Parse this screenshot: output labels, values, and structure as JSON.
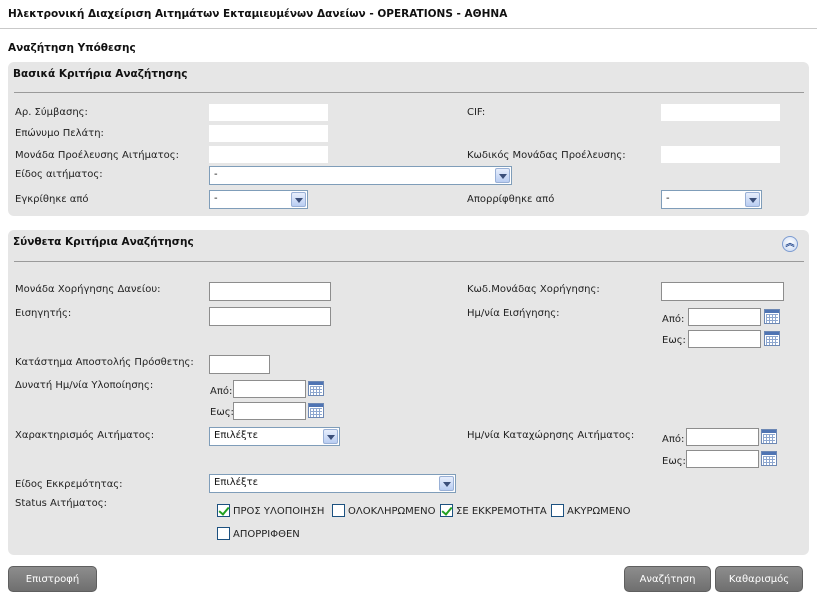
{
  "header": {
    "app_title": "Ηλεκτρονική Διαχείριση Αιτημάτων Εκταμιευμένων Δανείων - OPERATIONS - ΑΘΗΝΑ",
    "page_title": "Αναζήτηση Υπόθεσης"
  },
  "basic": {
    "heading": "Βασικά Κριτήρια Αναζήτησης",
    "contract_no_label": "Αρ. Σύμβασης:",
    "cif_label": "CIF:",
    "surname_label": "Επώνυμο Πελάτη:",
    "origin_unit_label": "Μονάδα Προέλευσης Αιτήματος:",
    "origin_unit_code_label": "Κωδικός Μονάδας Προέλευσης:",
    "request_type_label": "Είδος αιτήματος:",
    "request_type_value": "-",
    "approved_by_label": "Εγκρίθηκε από",
    "approved_by_value": "-",
    "rejected_by_label": "Απορρίφθηκε από",
    "rejected_by_value": "-"
  },
  "complex": {
    "heading": "Σύνθετα Κριτήρια Αναζήτησης",
    "collapse_icon": "double-chevron-up-icon",
    "granting_unit_label": "Μονάδα Χορήγησης Δανείου:",
    "granting_unit_code_label": "Κωδ.Μονάδας Χορήγησης:",
    "rapporteur_label": "Εισηγητής:",
    "proposal_date_label": "Ημ/νία Εισήγησης:",
    "from_label": "Από:",
    "to_label": "Εως:",
    "branch_label": "Κατάστημα Αποστολής Πρόσθετης:",
    "possible_date_label": "Δυνατή Ημ/νία Υλοποίησης:",
    "characterization_label": "Χαρακτηρισμός Αιτήματος:",
    "characterization_value": "Επιλέξτε",
    "registration_date_label": "Ημ/νία Καταχώρησης Αιτήματος:",
    "pending_type_label": "Είδος Εκκρεμότητας:",
    "pending_type_value": "Επιλέξτε",
    "status_label": "Status Αιτήματος:",
    "statuses": [
      {
        "label": "ΠΡΟΣ ΥΛΟΠΟΙΗΣΗ",
        "checked": true
      },
      {
        "label": "ΟΛΟΚΛΗΡΩΜΕΝΟ",
        "checked": false
      },
      {
        "label": "ΣΕ ΕΚΚΡΕΜΟΤΗΤΑ",
        "checked": true
      },
      {
        "label": "ΑΚΥΡΩΜΕΝΟ",
        "checked": false
      },
      {
        "label": "ΑΠΟΡΡΙΦΘΕΝ",
        "checked": false
      }
    ]
  },
  "footer": {
    "back_label": "Επιστροφή",
    "search_label": "Αναζήτηση",
    "clear_label": "Καθαρισμός"
  },
  "colors": {
    "panel_bg": "#e6e6e6",
    "button_bg": "#7d7d7d",
    "check_green": "#21a121"
  }
}
